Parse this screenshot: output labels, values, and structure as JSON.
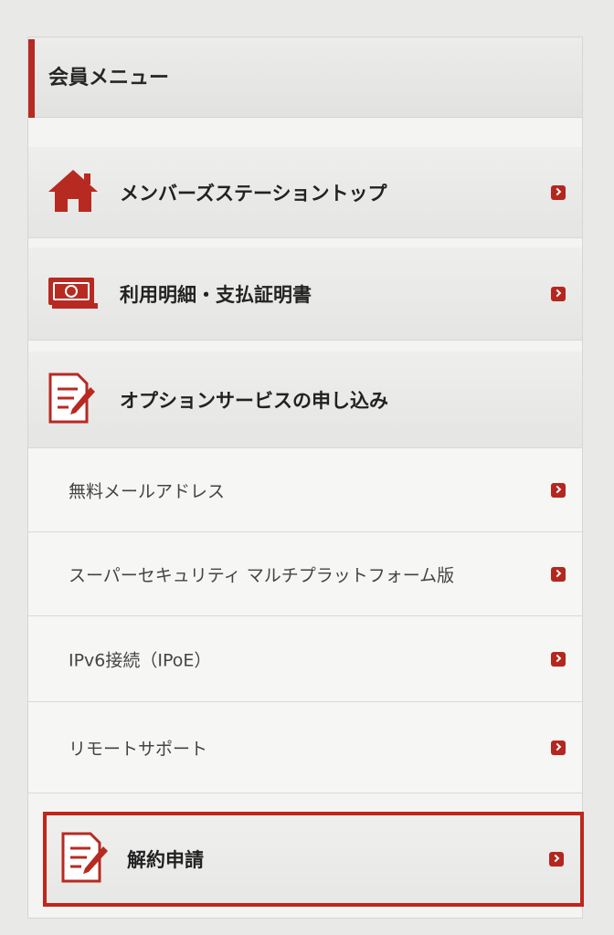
{
  "header": {
    "title": "会員メニュー"
  },
  "menu": {
    "top": {
      "label": "メンバーズステーショントップ",
      "icon": "home-icon"
    },
    "billing": {
      "label": "利用明細・支払証明書",
      "icon": "cash-icon"
    },
    "options": {
      "label": "オプションサービスの申し込み",
      "icon": "document-edit-icon"
    },
    "sub_items": [
      {
        "label": "無料メールアドレス"
      },
      {
        "label": "スーパーセキュリティ マルチプラットフォーム版"
      },
      {
        "label": "IPv6接続（IPoE）"
      },
      {
        "label": "リモートサポート"
      }
    ],
    "cancel": {
      "label": "解約申請",
      "icon": "document-edit-icon"
    }
  },
  "colors": {
    "accent": "#b72a22",
    "arrow": "#b3271f",
    "background": "#f4f4f2"
  }
}
